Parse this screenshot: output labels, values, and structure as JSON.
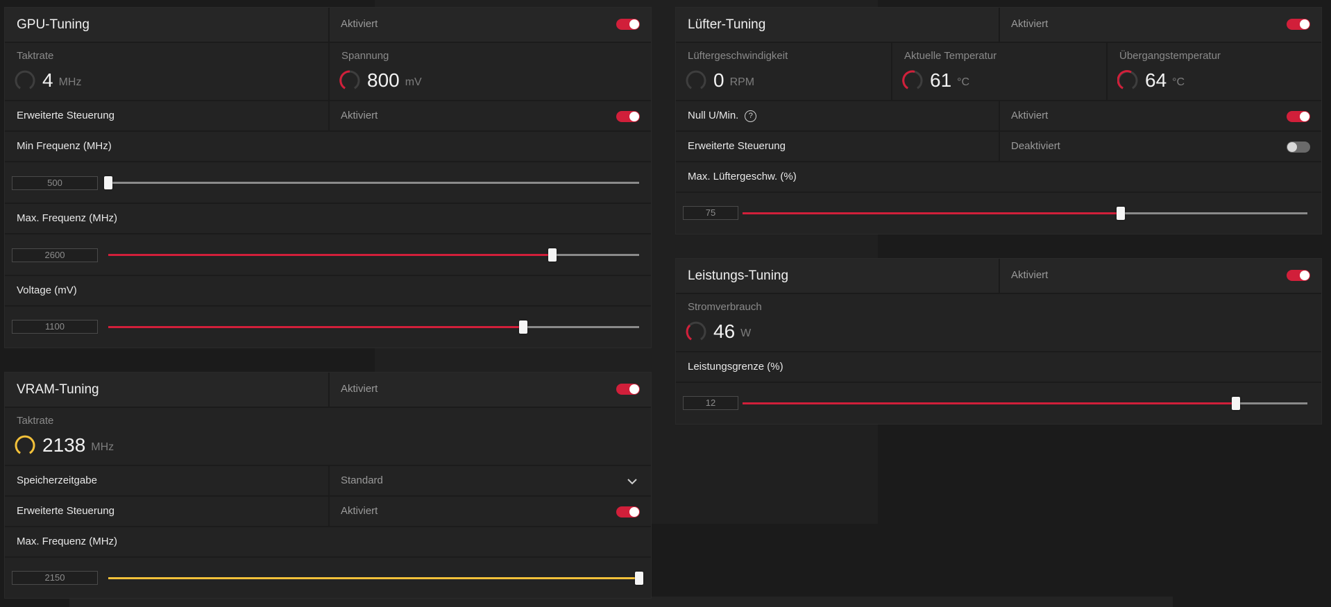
{
  "colors": {
    "accent": "#d11f3a",
    "vram_accent": "#f3c13a",
    "panel_bg": "#232323",
    "page_bg": "#1b1b1b"
  },
  "gpu_tuning": {
    "title": "GPU-Tuning",
    "status": "Aktiviert",
    "enabled": true,
    "clock": {
      "label": "Taktrate",
      "value": "4",
      "unit": "MHz",
      "gauge_level": 0.0
    },
    "voltage": {
      "label": "Spannung",
      "value": "800",
      "unit": "mV",
      "gauge_level": 0.35
    },
    "advanced": {
      "label": "Erweiterte Steuerung",
      "status": "Aktiviert",
      "enabled": true
    },
    "min_freq": {
      "label": "Min Frequenz (MHz)",
      "value": "500",
      "slider_fraction": 0.0
    },
    "max_freq": {
      "label": "Max. Frequenz (MHz)",
      "value": "2600",
      "slider_fraction": 0.836
    },
    "voltage_mv": {
      "label": "Voltage (mV)",
      "value": "1100",
      "slider_fraction": 0.782
    }
  },
  "vram_tuning": {
    "title": "VRAM-Tuning",
    "status": "Aktiviert",
    "enabled": true,
    "clock": {
      "label": "Taktrate",
      "value": "2138",
      "unit": "MHz",
      "gauge_level": 0.92
    },
    "timing": {
      "label": "Speicherzeitgabe",
      "value": "Standard"
    },
    "advanced": {
      "label": "Erweiterte Steuerung",
      "status": "Aktiviert",
      "enabled": true
    },
    "max_freq": {
      "label": "Max. Frequenz (MHz)",
      "value": "2150",
      "slider_fraction": 1.0
    }
  },
  "fan_tuning": {
    "title": "Lüfter-Tuning",
    "status": "Aktiviert",
    "enabled": true,
    "fan_speed": {
      "label": "Lüftergeschwindigkeit",
      "value": "0",
      "unit": "RPM",
      "gauge_level": 0.0
    },
    "current_temp": {
      "label": "Aktuelle Temperatur",
      "value": "61",
      "unit": "°C",
      "gauge_level": 0.5
    },
    "junction_temp": {
      "label": "Übergangstemperatur",
      "value": "64",
      "unit": "°C",
      "gauge_level": 0.55
    },
    "zero_rpm": {
      "label": "Null U/Min.",
      "help": "?",
      "status": "Aktiviert",
      "enabled": true
    },
    "advanced": {
      "label": "Erweiterte Steuerung",
      "status": "Deaktiviert",
      "enabled": false
    },
    "max_fan_speed": {
      "label": "Max. Lüftergeschw. (%)",
      "value": "75",
      "slider_fraction": 0.67
    }
  },
  "power_tuning": {
    "title": "Leistungs-Tuning",
    "status": "Aktiviert",
    "enabled": true,
    "power_draw": {
      "label": "Stromverbrauch",
      "value": "46",
      "unit": "W",
      "gauge_level": 0.3
    },
    "power_limit": {
      "label": "Leistungsgrenze (%)",
      "value": "12",
      "slider_fraction": 0.873
    }
  }
}
